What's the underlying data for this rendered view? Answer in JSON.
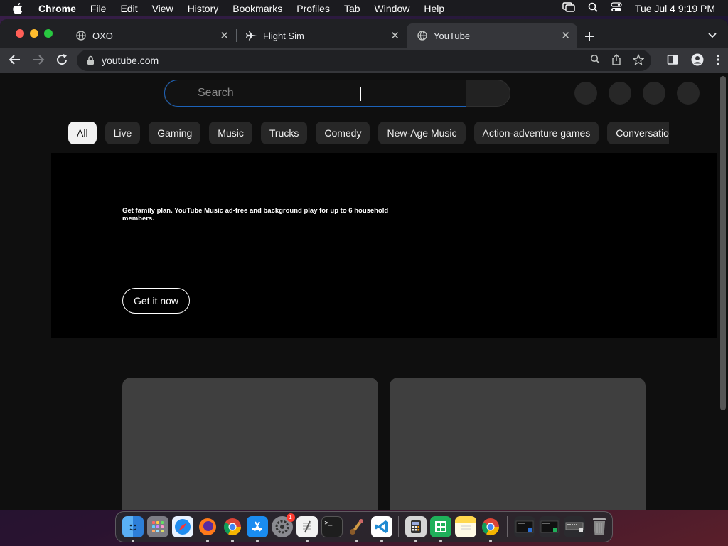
{
  "menubar": {
    "app": "Chrome",
    "items": [
      "File",
      "Edit",
      "View",
      "History",
      "Bookmarks",
      "Profiles",
      "Tab",
      "Window",
      "Help"
    ],
    "clock": "Tue Jul 4  9:19 PM"
  },
  "tabs": [
    {
      "title": "OXO",
      "icon": "globe-icon"
    },
    {
      "title": "Flight Sim",
      "icon": "airplane-icon"
    },
    {
      "title": "YouTube",
      "icon": "globe-icon",
      "active": true
    }
  ],
  "toolbar": {
    "url": "youtube.com"
  },
  "youtube": {
    "search_placeholder": "Search",
    "chips": [
      "All",
      "Live",
      "Gaming",
      "Music",
      "Trucks",
      "Comedy",
      "New-Age Music",
      "Action-adventure games",
      "Conversation"
    ],
    "banner": {
      "promo": "Get family plan. YouTube Music ad-free and background play for up to 6 household members.",
      "cta": "Get it now"
    }
  },
  "dock": {
    "apps": [
      "Finder",
      "Launchpad",
      "Safari",
      "Firefox",
      "Chrome",
      "App Store",
      "System Settings",
      "TextEdit",
      "Terminal",
      "Instruments",
      "VS Code",
      "Calculator",
      "Numbers",
      "Notes",
      "Chrome"
    ],
    "badge": "1"
  }
}
